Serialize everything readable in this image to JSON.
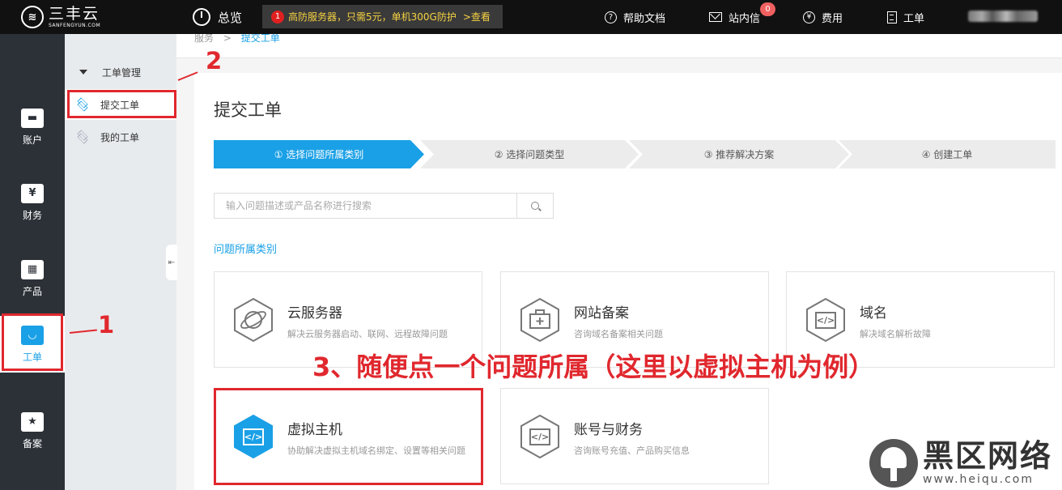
{
  "topbar": {
    "logo_cn": "三丰云",
    "logo_en": "SANFENGYUN.COM",
    "overview": "总览",
    "promo_badge": "1",
    "promo_text": "高防服务器，只需5元，单机300G防护",
    "promo_link": ">查看",
    "help_docs": "帮助文档",
    "messages": "站内信",
    "messages_count": "0",
    "billing": "费用",
    "tickets": "工单",
    "billing_icon": "¥"
  },
  "rail": {
    "items": [
      {
        "label": "账户",
        "icon": "id-card-icon"
      },
      {
        "label": "财务",
        "icon": "yen-icon",
        "glyph": "¥"
      },
      {
        "label": "产品",
        "icon": "grid-icon"
      },
      {
        "label": "工单",
        "icon": "bag-icon"
      },
      {
        "label": "备案",
        "icon": "star-icon",
        "glyph": "★"
      }
    ],
    "active_index": 3
  },
  "subnav": {
    "group": "工单管理",
    "items": [
      {
        "label": "提交工单",
        "active": true
      },
      {
        "label": "我的工单",
        "active": false
      }
    ]
  },
  "breadcrumb": {
    "parent": "服务",
    "sep": ">",
    "current": "提交工单"
  },
  "page": {
    "title": "提交工单",
    "steps": [
      "① 选择问题所属类别",
      "② 选择问题类型",
      "③ 推荐解决方案",
      "④ 创建工单"
    ],
    "search_placeholder": "输入问题描述或产品名称进行搜索",
    "category_title": "问题所属类别",
    "cards": [
      {
        "title": "云服务器",
        "desc": "解决云服务器启动、联网、远程故障问题",
        "icon": "planet-icon"
      },
      {
        "title": "网站备案",
        "desc": "咨询域名备案相关问题",
        "icon": "medkit-icon"
      },
      {
        "title": "域名",
        "desc": "解决域名解析故障",
        "icon": "code-icon",
        "glyph": "</>"
      },
      {
        "title": "虚拟主机",
        "desc": "协助解决虚拟主机域名绑定、设置等相关问题",
        "icon": "code-icon",
        "glyph": "</>",
        "highlight": true
      },
      {
        "title": "账号与财务",
        "desc": "咨询账号充值、产品购买信息",
        "icon": "code-icon",
        "glyph": "</>"
      }
    ]
  },
  "annotations": {
    "a1": "1",
    "a2": "2",
    "a3": "3、随便点一个问题所属（这里以虚拟主机为例）"
  },
  "watermark": {
    "cn": "黑区网络",
    "en": "www.heiqu.com"
  },
  "colors": {
    "accent": "#1aa0e6",
    "annotation": "#e0282e",
    "rail_bg": "#2c3138",
    "topbar_bg": "#111111"
  }
}
